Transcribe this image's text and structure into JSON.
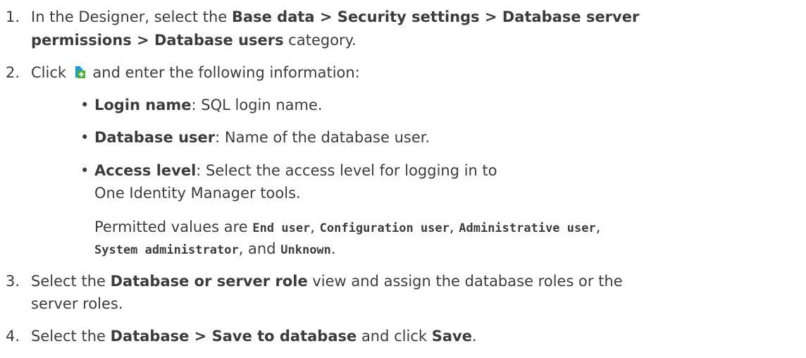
{
  "steps": [
    {
      "num": "1.",
      "t1": "In the Designer, select the ",
      "b1": "Base data > Security settings > Database server",
      "b2": "permissions > Database users",
      "t2": " category."
    },
    {
      "num": "2.",
      "t1": "Click ",
      "icon": "add-document-icon",
      "t2": " and enter the following information:",
      "bullets": [
        {
          "label": "Login name",
          "text": ": SQL login name."
        },
        {
          "label": "Database user",
          "text": ": Name of the database user."
        },
        {
          "label": "Access level",
          "text1": ": Select the access level for logging in to",
          "text2": "One Identity Manager tools.",
          "note": {
            "pre": "Permitted values are ",
            "v1": "End user",
            "s1": ", ",
            "v2": "Configuration user",
            "s2": ", ",
            "v3": "Administrative user",
            "s3": ",",
            "v4": "System administrator",
            "s4": ", and ",
            "v5": "Unknown",
            "end": "."
          }
        }
      ]
    },
    {
      "num": "3.",
      "t1": "Select the ",
      "b1": "Database or server role",
      "t2": " view and assign the database roles or the",
      "t3": "server roles."
    },
    {
      "num": "4.",
      "t1": "Select the ",
      "b1": "Database > Save to database",
      "t2": " and click ",
      "b2": "Save",
      "t3": "."
    }
  ],
  "colors": {
    "text": "#3c3c3c",
    "icon_blue": "#1f9bd7",
    "icon_green": "#45b035"
  }
}
